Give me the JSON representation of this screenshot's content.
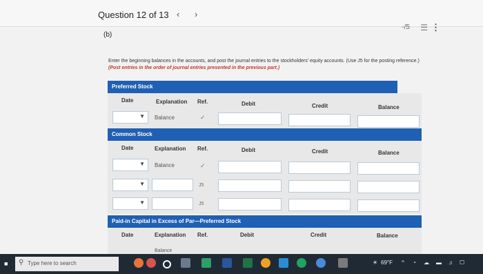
{
  "header": {
    "question_label": "Question 12 of 13",
    "prev_icon": "chevron-left",
    "next_icon": "chevron-right",
    "score": "-/5",
    "list_icon": "list",
    "more_icon": "more-vertical"
  },
  "part_label": "(b)",
  "instructions": {
    "text": "Enter the beginning balances in the accounts, and post the journal entries to the stockholders' equity accounts. (Use J5 for the posting reference.)",
    "emphasis": "(Post entries in the order of journal entries presented in the previous part.)"
  },
  "columns": {
    "date": "Date",
    "explanation": "Explanation",
    "ref": "Ref.",
    "debit": "Debit",
    "credit": "Credit",
    "balance": "Balance"
  },
  "accounts": [
    {
      "title": "Preferred Stock",
      "rows": [
        {
          "explanation": "Balance",
          "ref": "✓"
        }
      ]
    },
    {
      "title": "Common Stock",
      "rows": [
        {
          "explanation": "Balance",
          "ref": "✓"
        },
        {
          "explanation": "",
          "ref": "J5"
        },
        {
          "explanation": "",
          "ref": "J5"
        }
      ]
    },
    {
      "title": "Paid-in Capital in Excess of Par—Preferred Stock",
      "rows": [
        {
          "explanation": "Balance",
          "ref": "✓"
        }
      ]
    }
  ],
  "taskbar": {
    "search_placeholder": "Type here to search",
    "temperature": "69°F"
  }
}
